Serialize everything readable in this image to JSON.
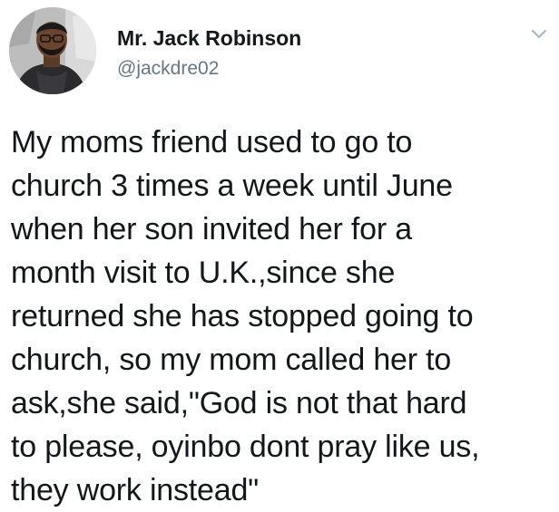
{
  "tweet": {
    "author": {
      "display_name": "Mr. Jack Robinson",
      "handle": "@jackdre02"
    },
    "text": "My moms friend used to go to\nchurch 3 times a week until June\nwhen her son invited her for a\nmonth visit to U.K.,since she\nreturned she has stopped going to\nchurch, so my mom called her to\nask,she said,\"God is not that hard\nto please, oyinbo dont pray like us,\nthey work instead\""
  },
  "icons": {
    "avatar": "profile-photo",
    "menu": "chevron-down-icon"
  },
  "colors": {
    "name": "#14171a",
    "handle": "#657786",
    "caret": "#aab8c2",
    "background": "#ffffff"
  }
}
